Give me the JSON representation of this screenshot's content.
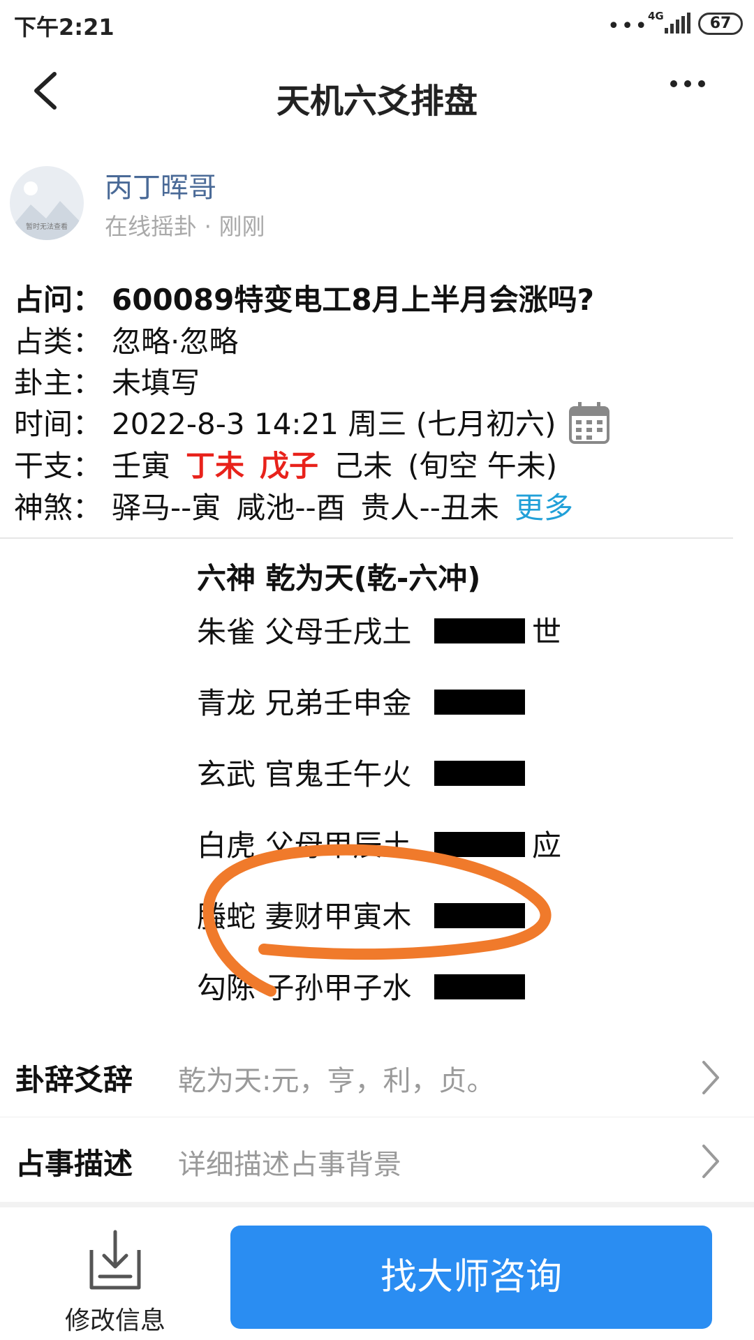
{
  "status_bar": {
    "time": "下午2:21",
    "dots": "•••",
    "network": "4G",
    "battery": "67"
  },
  "header": {
    "title": "天机六爻排盘"
  },
  "user": {
    "name": "丙丁晖哥",
    "meta": "在线摇卦 · 刚刚",
    "avatar_caption": "暂时无法查看"
  },
  "info": {
    "question": {
      "label": "占问：",
      "value": "600089特变电工8月上半月会涨吗?"
    },
    "category": {
      "label": "占类：",
      "value": "忽略·忽略"
    },
    "owner": {
      "label": "卦主：",
      "value": "未填写"
    },
    "time": {
      "label": "时间：",
      "value": "2022-8-3 14:21 周三 (七月初六)"
    },
    "ganzhi": {
      "label": "干支：",
      "year": "壬寅",
      "month": "丁未",
      "day": "戊子",
      "hour": "己未",
      "void": "(旬空 午未)"
    },
    "shensha": {
      "label": "神煞：",
      "items": [
        "驿马--寅",
        "咸池--酉",
        "贵人--丑未"
      ],
      "more": "更多"
    }
  },
  "hexagram": {
    "header": "六神  乾为天(乾-六冲)",
    "lines": [
      {
        "text": "朱雀 父母壬戌土",
        "mark": "世"
      },
      {
        "text": "青龙 兄弟壬申金",
        "mark": ""
      },
      {
        "text": "玄武 官鬼壬午火",
        "mark": ""
      },
      {
        "text": "白虎 父母甲辰土",
        "mark": "应"
      },
      {
        "text": "螣蛇 妻财甲寅木",
        "mark": ""
      },
      {
        "text": "勾陈 子孙甲子水",
        "mark": ""
      }
    ],
    "annotation_color": "#f07a2b"
  },
  "rows": {
    "yao": {
      "label": "卦辞爻辞",
      "value": "乾为天:元，亨，利，贞。"
    },
    "desc": {
      "label": "占事描述",
      "value": "详细描述占事背景"
    }
  },
  "bottom": {
    "edit_label": "修改信息",
    "consult_label": "找大师咨询",
    "accent": "#2a8df2"
  }
}
